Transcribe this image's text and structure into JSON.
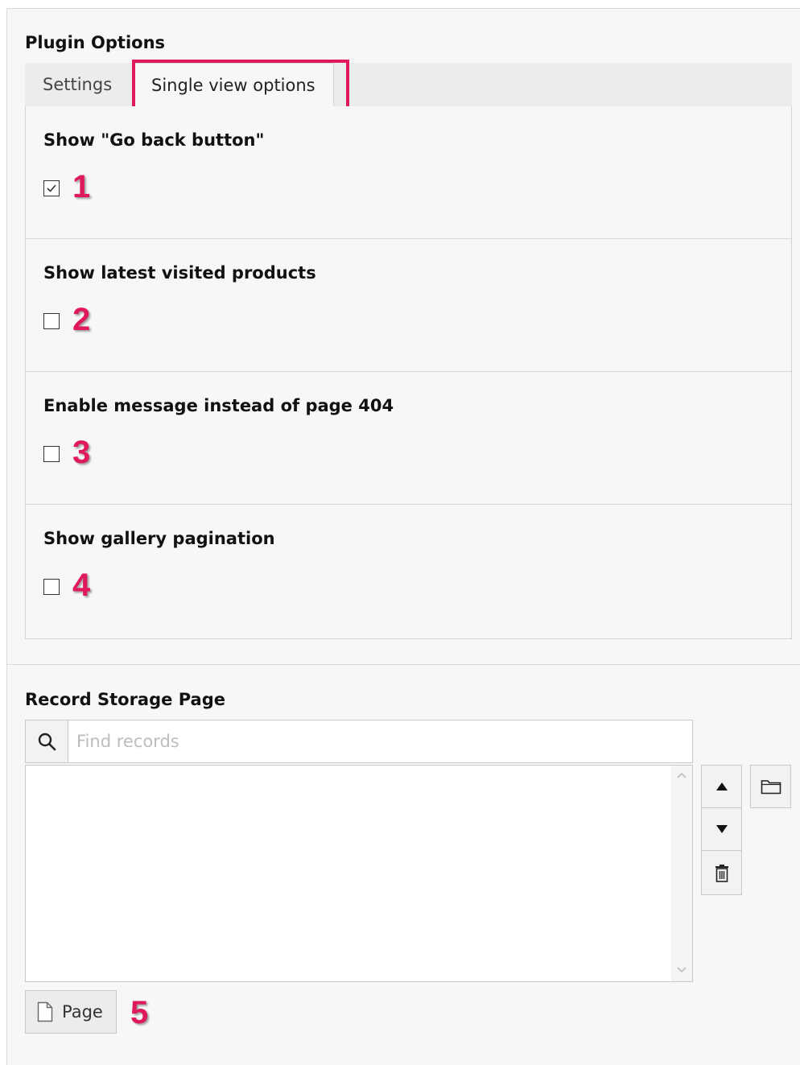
{
  "plugin_options": {
    "title": "Plugin Options",
    "tabs": [
      {
        "label": "Settings",
        "active": false
      },
      {
        "label": "Single view options",
        "active": true
      }
    ],
    "options": [
      {
        "label": "Show \"Go back button\"",
        "checked": true,
        "marker": "1"
      },
      {
        "label": "Show latest visited products",
        "checked": false,
        "marker": "2"
      },
      {
        "label": "Enable message instead of page 404",
        "checked": false,
        "marker": "3"
      },
      {
        "label": "Show gallery pagination",
        "checked": false,
        "marker": "4"
      }
    ]
  },
  "record_storage": {
    "title": "Record Storage Page",
    "search_placeholder": "Find records",
    "search_value": "",
    "buttons": {
      "move_up_icon": "triangle-up-icon",
      "move_down_icon": "triangle-down-icon",
      "delete_icon": "trash-icon",
      "browse_icon": "folder-icon"
    },
    "page_button_label": "Page",
    "page_button_marker": "5"
  },
  "colors": {
    "highlight": "#e0195b",
    "panel_bg": "#f7f7f7",
    "tab_bar_bg": "#ececec"
  }
}
